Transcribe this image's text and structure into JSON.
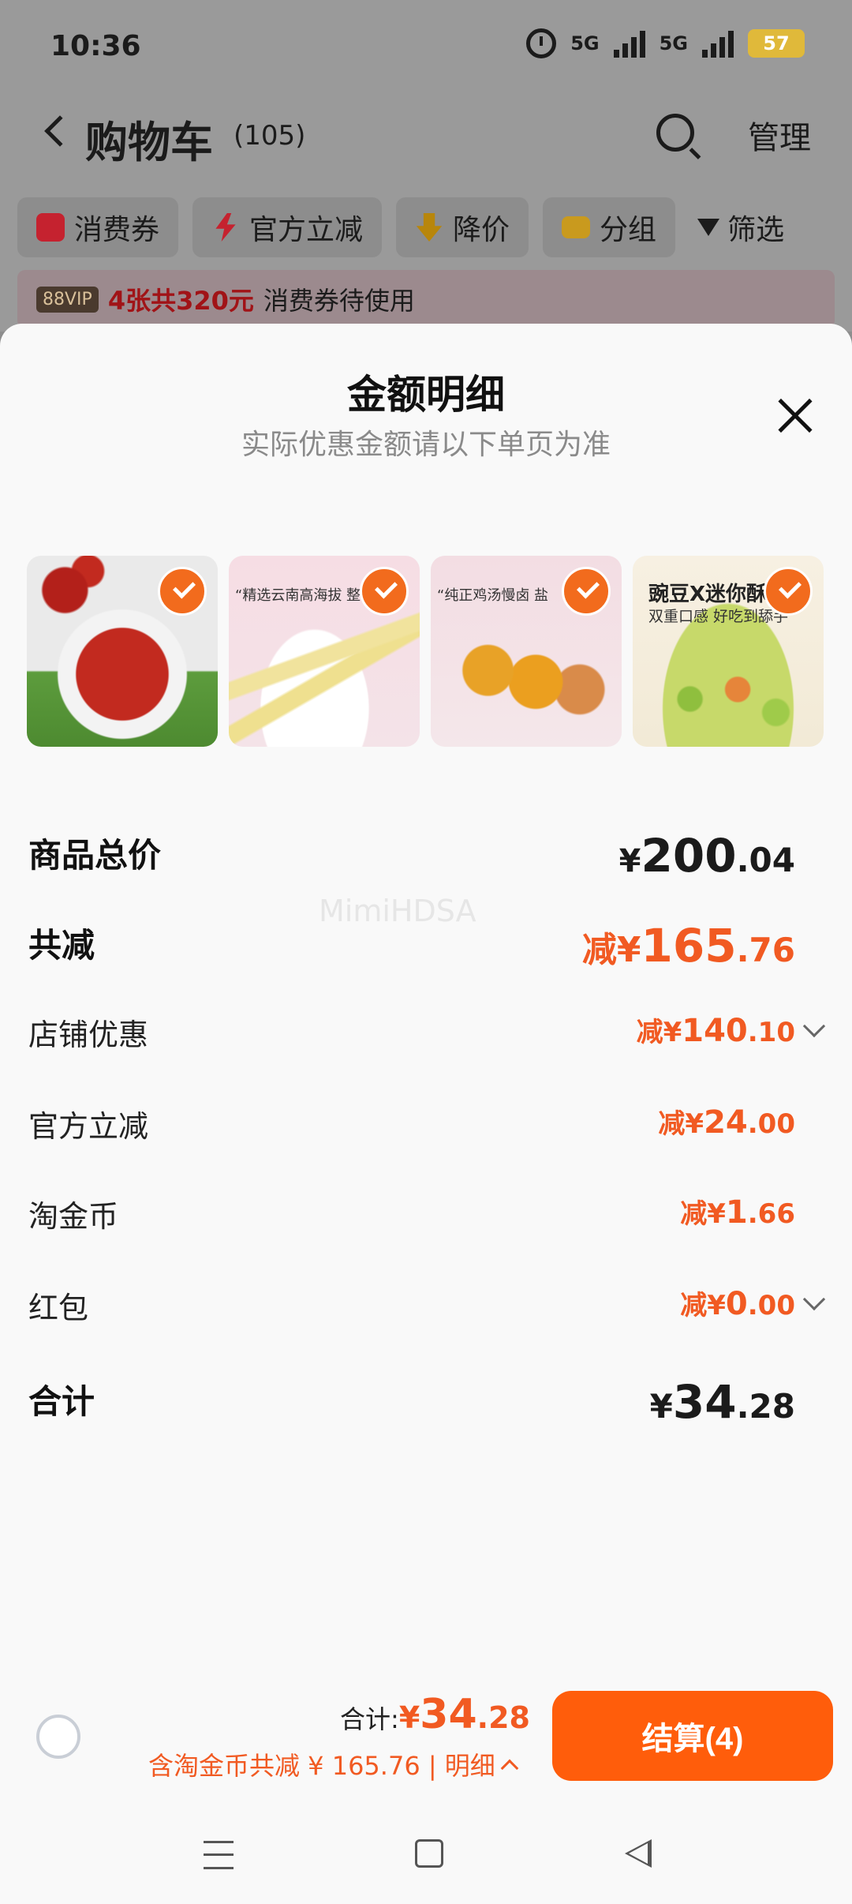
{
  "status_bar": {
    "time": "10:36",
    "network1": "5G",
    "network2": "5G",
    "battery": "57"
  },
  "nav": {
    "title": "购物车",
    "count": "(105)",
    "manage": "管理"
  },
  "filters": [
    {
      "label": "消费券",
      "icon": "coupon-icon",
      "color": "#c5222f"
    },
    {
      "label": "官方立减",
      "icon": "lightning-icon",
      "color": "#c5222f"
    },
    {
      "label": "降价",
      "icon": "price-drop-icon",
      "color": "#b8860b"
    },
    {
      "label": "分组",
      "icon": "folder-icon",
      "color": "#c99a1e"
    },
    {
      "label": "筛选",
      "icon": "funnel-icon"
    }
  ],
  "vip_banner": {
    "tag": "88VIP",
    "highlight": "4张共320元",
    "text": "消费券待使用"
  },
  "sheet": {
    "title": "金额明细",
    "subtitle": "实际优惠金额请以下单页为准",
    "watermark": "MimiHDSA",
    "products": [
      {
        "caption": ""
      },
      {
        "caption": "“精选云南高海拔 整"
      },
      {
        "caption": "“纯正鸡汤慢卤 盐"
      },
      {
        "title": "豌豆X迷你酥",
        "sub": "双重口感 好吃到舔手"
      }
    ],
    "rows": [
      {
        "label": "商品总价",
        "prefix": "¥",
        "int": "200",
        "dec": ".04"
      },
      {
        "label": "共减",
        "prefix": "减¥",
        "int": "165",
        "dec": ".76"
      },
      {
        "label": "店铺优惠",
        "prefix": "减¥",
        "int": "140",
        "dec": ".10"
      },
      {
        "label": "官方立减",
        "prefix": "减¥",
        "int": "24",
        "dec": ".00"
      },
      {
        "label": "淘金币",
        "prefix": "减¥",
        "int": "1",
        "dec": ".66"
      },
      {
        "label": "红包",
        "prefix": "减¥",
        "int": "0",
        "dec": ".00"
      },
      {
        "label": "合计",
        "prefix": "¥",
        "int": "34",
        "dec": ".28"
      }
    ]
  },
  "checkout": {
    "total_label": "合计:",
    "currency": "¥",
    "total_int": "34",
    "total_dec": ".28",
    "detail_text": "含淘金币共减 ¥ 165.76 | 明细",
    "pay_label": "结算(4)"
  },
  "colors": {
    "accent": "#ff5d0b",
    "discount": "#f15a22"
  }
}
